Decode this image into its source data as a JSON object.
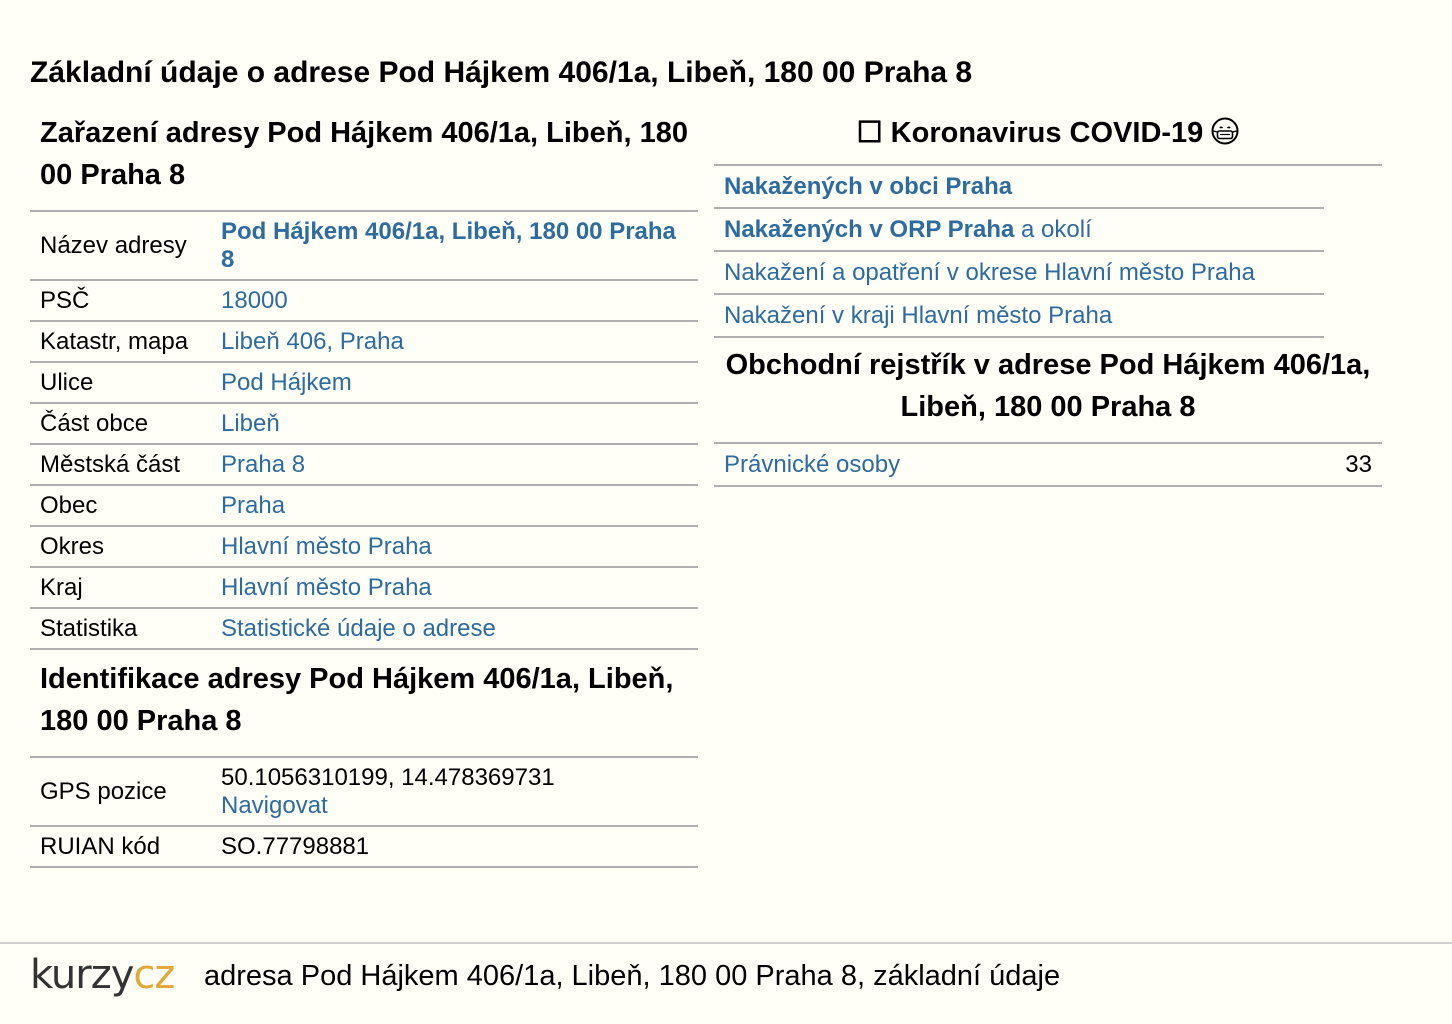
{
  "page_title": "Základní údaje o adrese Pod Hájkem 406/1a, Libeň, 180 00 Praha 8",
  "zarazeni": {
    "title": "Zařazení adresy Pod Hájkem 406/1a, Libeň, 180 00 Praha 8",
    "rows": [
      {
        "label": "Název adresy",
        "value": "Pod Hájkem 406/1a, Libeň, 180 00 Praha 8"
      },
      {
        "label": "PSČ",
        "value": "18000"
      },
      {
        "label": "Katastr, mapa",
        "value": "Libeň 406, Praha"
      },
      {
        "label": "Ulice",
        "value": "Pod Hájkem"
      },
      {
        "label": "Část obce",
        "value": "Libeň"
      },
      {
        "label": "Městská část",
        "value": "Praha 8"
      },
      {
        "label": "Obec",
        "value": "Praha"
      },
      {
        "label": "Okres",
        "value": "Hlavní město Praha"
      },
      {
        "label": "Kraj",
        "value": "Hlavní město Praha"
      },
      {
        "label": "Statistika",
        "value": "Statistické údaje o adrese"
      }
    ]
  },
  "identifikace": {
    "title": "Identifikace adresy Pod Hájkem 406/1a, Libeň, 180 00 Praha 8",
    "gps_label": "GPS pozice",
    "gps_value": "50.1056310199, 14.478369731",
    "navigate_label": "Navigovat",
    "ruian_label": "RUIAN kód",
    "ruian_value": "SO.77798881"
  },
  "covid": {
    "title_prefix": "☐",
    "title": "Koronavirus COVID-19",
    "icon": "mask-face-icon",
    "items": [
      {
        "bold": "Nakažených v obci Praha",
        "rest": ""
      },
      {
        "bold": "Nakažených v ORP Praha",
        "rest": " a okolí"
      },
      {
        "bold": "",
        "rest": "Nakažení a opatření v okrese Hlavní město Praha"
      },
      {
        "bold": "",
        "rest": "Nakažení v kraji Hlavní město Praha"
      }
    ]
  },
  "obchodni": {
    "title": "Obchodní rejstřík v adrese Pod Hájkem 406/1a, Libeň, 180 00 Praha 8",
    "row_label": "Právnické osoby",
    "row_count": "33"
  },
  "footer": {
    "logo_part1": "kurzy",
    "logo_part2": "cz",
    "text": "adresa Pod Hájkem 406/1a, Libeň, 180 00 Praha 8, základní údaje"
  },
  "colors": {
    "link": "#2e6b9e",
    "background": "#fffff7",
    "logo_accent": "#e2a93a"
  }
}
